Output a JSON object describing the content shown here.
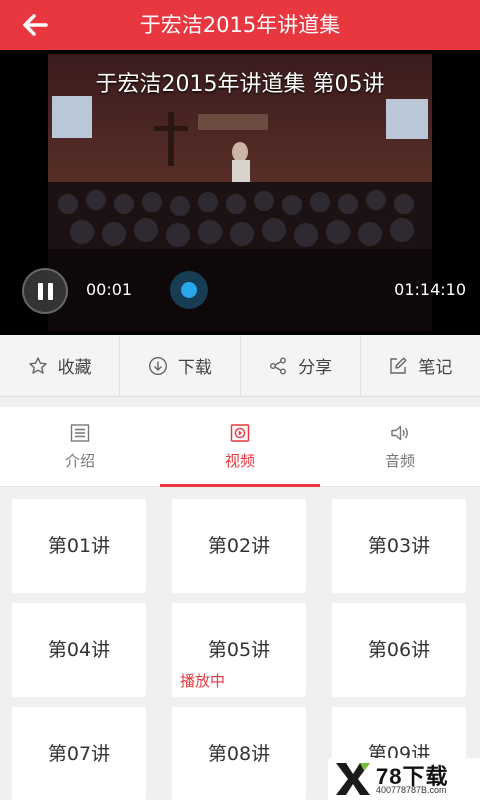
{
  "header": {
    "title": "于宏洁2015年讲道集"
  },
  "player": {
    "overlay_title": "于宏洁2015年讲道集 第05讲",
    "current_time": "00:01",
    "total_time": "01:14:10",
    "progress": 0.0
  },
  "actions": [
    {
      "label": "收藏",
      "icon": "star-icon"
    },
    {
      "label": "下载",
      "icon": "download-icon"
    },
    {
      "label": "分享",
      "icon": "share-icon"
    },
    {
      "label": "笔记",
      "icon": "edit-icon"
    }
  ],
  "tabs": [
    {
      "label": "介绍",
      "icon": "list-icon",
      "active": false
    },
    {
      "label": "视频",
      "icon": "video-icon",
      "active": true
    },
    {
      "label": "音频",
      "icon": "speaker-icon",
      "active": false
    }
  ],
  "episodes": [
    {
      "label": "第01讲",
      "status": ""
    },
    {
      "label": "第02讲",
      "status": ""
    },
    {
      "label": "第03讲",
      "status": ""
    },
    {
      "label": "第04讲",
      "status": ""
    },
    {
      "label": "第05讲",
      "status": "播放中"
    },
    {
      "label": "第06讲",
      "status": ""
    },
    {
      "label": "第07讲",
      "status": ""
    },
    {
      "label": "第08讲",
      "status": ""
    },
    {
      "label": "第09讲",
      "status": ""
    }
  ],
  "watermark": {
    "brand": "78下载",
    "url": "400778787B.com"
  },
  "colors": {
    "accent": "#e8373f",
    "seek": "#2aa7e8"
  }
}
